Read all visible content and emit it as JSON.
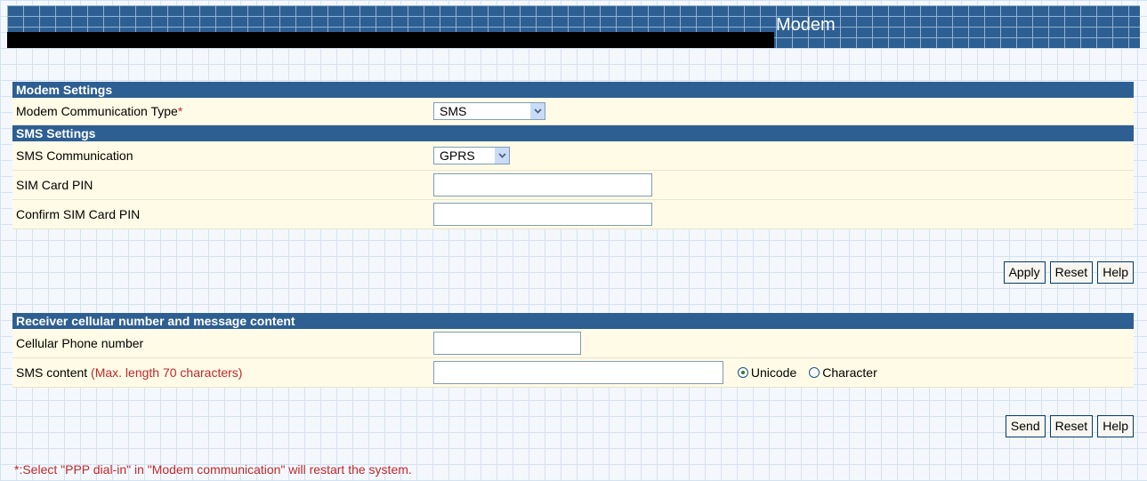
{
  "header": {
    "title": "Modem"
  },
  "modem_settings": {
    "title": "Modem Settings",
    "comm_type_label": "Modem Communication Type",
    "required_mark": "*",
    "comm_type_value": "SMS"
  },
  "sms_settings": {
    "title": "SMS Settings",
    "sms_comm_label": "SMS Communication",
    "sms_comm_value": "GPRS",
    "pin_label": "SIM Card PIN",
    "pin_value": "",
    "confirm_pin_label": "Confirm SIM Card PIN",
    "confirm_pin_value": ""
  },
  "buttons_top": {
    "apply": "Apply",
    "reset": "Reset",
    "help": "Help"
  },
  "receiver": {
    "title": "Receiver cellular number and message content",
    "phone_label": "Cellular Phone number",
    "phone_value": "",
    "sms_content_label": "SMS content",
    "sms_content_note": "(Max. length 70 characters)",
    "sms_content_value": "",
    "encoding_options": [
      "Unicode",
      "Character"
    ],
    "encoding_selected": "Unicode"
  },
  "buttons_bottom": {
    "send": "Send",
    "reset": "Reset",
    "help": "Help"
  },
  "footer": {
    "note": "*:Select \"PPP dial-in\" in \"Modem communication\" will restart the system."
  },
  "colors": {
    "section_header": "#2e5f93",
    "row_background": "#fffbe6",
    "note_text": "#c0282c"
  }
}
